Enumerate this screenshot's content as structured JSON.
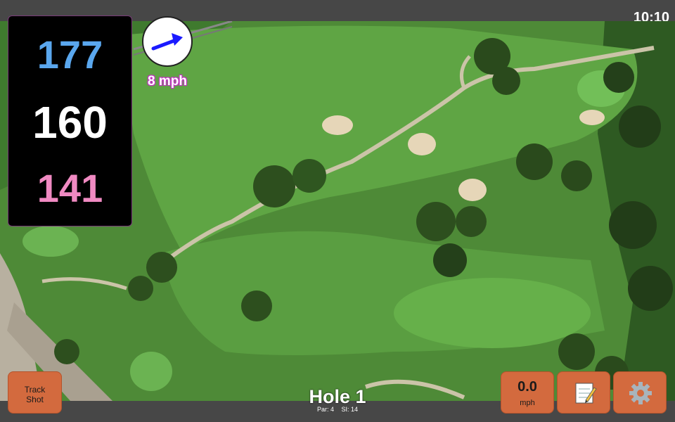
{
  "status": {
    "time": "10:10"
  },
  "distances": {
    "back": "177",
    "middle": "160",
    "front": "141"
  },
  "wind": {
    "speed": "8 mph",
    "icon": "wind-direction-arrow-icon",
    "arrow_color": "#1a1aff"
  },
  "hole": {
    "title": "Hole 1",
    "par": "Par: 4",
    "stroke_index": "SI: 14"
  },
  "buttons": {
    "track_shot_line1": "Track",
    "track_shot_line2": "Shot",
    "speed_value": "0.0",
    "speed_unit": "mph",
    "notes_icon": "notepad-icon",
    "settings_icon": "gear-icon"
  },
  "colors": {
    "back_distance": "#5aa7ee",
    "middle_distance": "#ffffff",
    "front_distance": "#f08ac2",
    "button": "#d36a3e",
    "fairway": "#5a9a3e"
  }
}
